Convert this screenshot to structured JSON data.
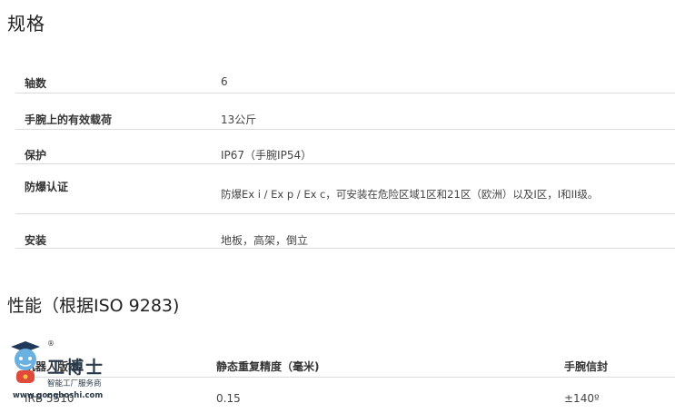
{
  "spec": {
    "title": "规格",
    "rows": [
      {
        "label": "轴数",
        "value": "6"
      },
      {
        "label": "手腕上的有效载荷",
        "value": "13公斤"
      },
      {
        "label": "保护",
        "value": "IP67（手腕IP54）"
      },
      {
        "label": "防爆认证",
        "value": "防爆Ex i / Ex p / Ex c，可安装在危险区域1区和21区（欧洲）以及I区，I和II级。"
      },
      {
        "label": "安装",
        "value": "地板，高架，倒立"
      }
    ]
  },
  "performance": {
    "title": "性能（根据ISO 9283)",
    "headers": [
      "机器人版本",
      "静态重复精度（毫米)",
      "手腕信封"
    ],
    "rows": [
      {
        "c1": "IRB 5510",
        "c2": "0.15",
        "c3": "±140º"
      }
    ]
  },
  "watermark": {
    "logo_text": "工博士",
    "tagline": "智能工厂服务商",
    "url": "www.gongboshi.com",
    "registered": "®"
  }
}
